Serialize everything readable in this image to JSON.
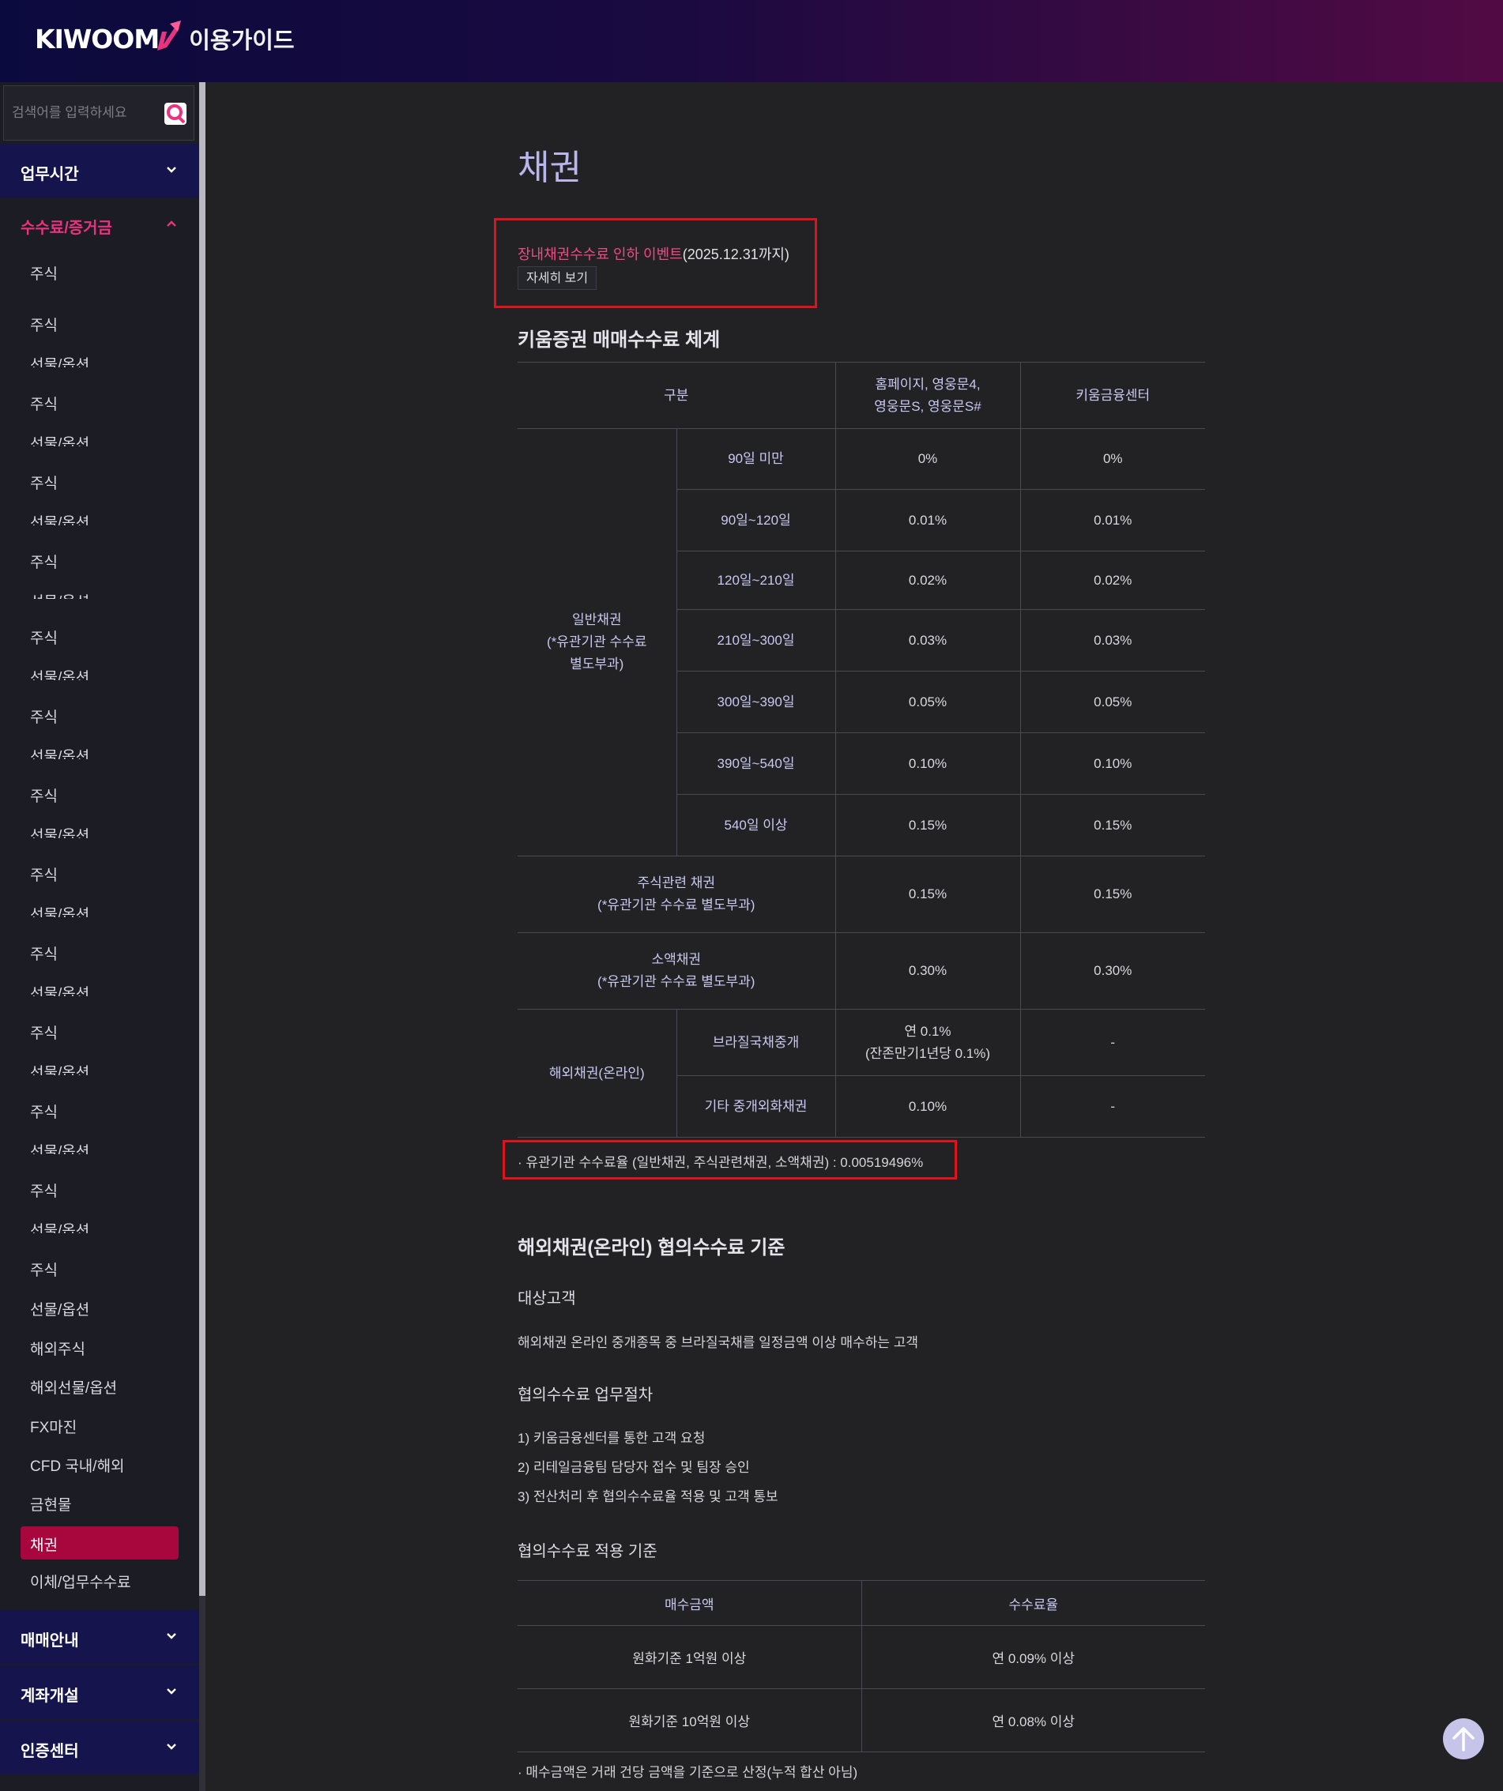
{
  "header": {
    "logo_text": "KIWOOM",
    "subtitle": "이용가이드",
    "brand_color": "#e8337f"
  },
  "sidebar": {
    "search_placeholder": "검색어를 입력하세요",
    "menus": [
      {
        "label": "업무시간",
        "open": false
      },
      {
        "label": "수수료/증거금",
        "open": true
      },
      {
        "label": "매매안내",
        "open": false
      },
      {
        "label": "계좌개설",
        "open": false
      },
      {
        "label": "인증센터",
        "open": false
      }
    ],
    "sub_items": [
      "주식",
      "주식",
      "선물/옵션",
      "주식",
      "선물/옵션",
      "주식",
      "선물/옵션",
      "주식",
      "선물/옵션",
      "주식",
      "선물/옵션",
      "주식",
      "선물/옵션",
      "주식",
      "선물/옵션",
      "주식",
      "선물/옵션",
      "주식",
      "선물/옵션",
      "주식",
      "선물/옵션",
      "주식",
      "선물/옵션",
      "주식",
      "선물/옵션",
      "주식",
      "선물/옵션",
      "해외주식",
      "해외선물/옵션",
      "FX마진",
      "CFD 국내/해외",
      "금현물",
      "채권",
      "이체/업무수수료"
    ],
    "active_item": "채권"
  },
  "main": {
    "title": "채권",
    "event": {
      "link": "장내채권수수료 인하 이벤트",
      "period": "(2025.12.31까지)",
      "button": "자세히 보기"
    },
    "fee_section": {
      "heading": "키움증권 매매수수료 체계",
      "headers": [
        "구분",
        "홈페이지, 영웅문4,\n영웅문S, 영웅문S#",
        "키움금융센터"
      ],
      "general_label": "일반채권\n(*유관기관 수수료\n별도부과)",
      "general_rows": [
        {
          "period": "90일 미만",
          "online": "0%",
          "center": "0%"
        },
        {
          "period": "90일~120일",
          "online": "0.01%",
          "center": "0.01%"
        },
        {
          "period": "120일~210일",
          "online": "0.02%",
          "center": "0.02%"
        },
        {
          "period": "210일~300일",
          "online": "0.03%",
          "center": "0.03%"
        },
        {
          "period": "300일~390일",
          "online": "0.05%",
          "center": "0.05%"
        },
        {
          "period": "390일~540일",
          "online": "0.10%",
          "center": "0.10%"
        },
        {
          "period": "540일 이상",
          "online": "0.15%",
          "center": "0.15%"
        }
      ],
      "equity_linked": {
        "label": "주식관련 채권\n(*유관기관 수수료 별도부과)",
        "online": "0.15%",
        "center": "0.15%"
      },
      "small": {
        "label": "소액채권\n(*유관기관 수수료 별도부과)",
        "online": "0.30%",
        "center": "0.30%"
      },
      "overseas": {
        "label": "해외채권(온라인)",
        "rows": [
          {
            "name": "브라질국채중개",
            "online": "연 0.1%\n(잔존만기1년당 0.1%)",
            "center": "-"
          },
          {
            "name": "기타 중개외화채권",
            "online": "0.10%",
            "center": "-"
          }
        ]
      },
      "note": "· 유관기관 수수료율 (일반채권, 주식관련채권, 소액채권) : 0.00519496%"
    },
    "overseas_section": {
      "heading": "해외채권(온라인) 협의수수료 기준",
      "target_title": "대상고객",
      "target_desc": "해외채권 온라인 중개종목 중 브라질국채를 일정금액 이상 매수하는 고객",
      "process_title": "협의수수료 업무절차",
      "process_steps": [
        "1) 키움금융센터를 통한 고객 요청",
        "2) 리테일금융팀 담당자 접수 및 팀장 승인",
        "3) 전산처리 후 협의수수료율 적용 및 고객 통보"
      ],
      "criteria_title": "협의수수료 적용 기준",
      "criteria_headers": [
        "매수금액",
        "수수료율"
      ],
      "criteria_rows": [
        {
          "amount": "원화기준 1억원 이상",
          "rate": "연 0.09% 이상"
        },
        {
          "amount": "원화기준 10억원 이상",
          "rate": "연 0.08% 이상"
        }
      ],
      "criteria_note": "· 매수금액은 거래 건당 금액을 기준으로 산정(누적 합산 아님)"
    }
  },
  "icons": {
    "search": "search-icon",
    "chevron": "chevron-icon",
    "scroll_top": "arrow-up-icon"
  }
}
